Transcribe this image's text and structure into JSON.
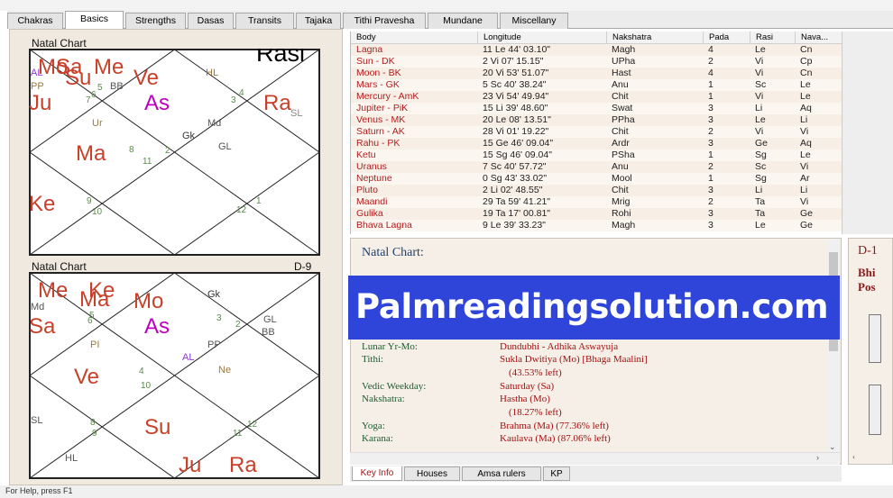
{
  "tabs": [
    "Chakras",
    "Basics",
    "Strengths",
    "Dasas",
    "Transits",
    "Tajaka",
    "Tithi Pravesha",
    "Mundane",
    "Miscellany"
  ],
  "active_tab": "Basics",
  "rasi_chart": {
    "title": "Natal Chart",
    "name": "Rasi",
    "planets": [
      {
        "label": "Mo",
        "color": "#c8402a",
        "size": 24
      },
      {
        "label": "Sa",
        "color": "#c8402a",
        "size": 24
      },
      {
        "label": "Me",
        "color": "#c8402a",
        "size": 24
      },
      {
        "label": "Su",
        "color": "#c8402a",
        "size": 24
      },
      {
        "label": "Ve",
        "color": "#c8402a",
        "size": 24
      },
      {
        "label": "AL",
        "color": "#8a3ad0",
        "size": 11
      },
      {
        "label": "PP",
        "color": "#9a7840",
        "size": 11
      },
      {
        "label": "BB",
        "color": "#555",
        "size": 11
      },
      {
        "label": "HL",
        "color": "#9a7840",
        "size": 11
      },
      {
        "label": "Ju",
        "color": "#c8402a",
        "size": 24
      },
      {
        "label": "As",
        "color": "#c000c0",
        "size": 24
      },
      {
        "label": "Ra",
        "color": "#c8402a",
        "size": 24
      },
      {
        "label": "SL",
        "color": "#888",
        "size": 11
      },
      {
        "label": "Ur",
        "color": "#9a7840",
        "size": 11
      },
      {
        "label": "Md",
        "color": "#555",
        "size": 11
      },
      {
        "label": "Gk",
        "color": "#333",
        "size": 11
      },
      {
        "label": "GL",
        "color": "#555",
        "size": 11
      },
      {
        "label": "Ma",
        "color": "#c8402a",
        "size": 24
      },
      {
        "label": "Ke",
        "color": "#c8402a",
        "size": 24
      }
    ],
    "house_numbers": [
      "6",
      "5",
      "7",
      "4",
      "3",
      "8",
      "2",
      "11",
      "9",
      "10",
      "12",
      "1"
    ]
  },
  "navamsa_chart": {
    "title": "Natal Chart",
    "name": "D-9",
    "planets": [
      {
        "label": "Me",
        "color": "#c8402a",
        "size": 24
      },
      {
        "label": "Ke",
        "color": "#c8402a",
        "size": 24
      },
      {
        "label": "Ma",
        "color": "#c8402a",
        "size": 24
      },
      {
        "label": "Mo",
        "color": "#c8402a",
        "size": 24
      },
      {
        "label": "Gk",
        "color": "#333",
        "size": 11
      },
      {
        "label": "Md",
        "color": "#555",
        "size": 11
      },
      {
        "label": "Sa",
        "color": "#c8402a",
        "size": 24
      },
      {
        "label": "As",
        "color": "#c000c0",
        "size": 24
      },
      {
        "label": "GL",
        "color": "#555",
        "size": 11
      },
      {
        "label": "BB",
        "color": "#555",
        "size": 11
      },
      {
        "label": "PI",
        "color": "#9a7840",
        "size": 11
      },
      {
        "label": "PP",
        "color": "#555",
        "size": 11
      },
      {
        "label": "AL",
        "color": "#8a3ad0",
        "size": 11
      },
      {
        "label": "Ve",
        "color": "#c8402a",
        "size": 24
      },
      {
        "label": "Ne",
        "color": "#9a7840",
        "size": 11
      },
      {
        "label": "SL",
        "color": "#555",
        "size": 11
      },
      {
        "label": "Su",
        "color": "#c8402a",
        "size": 24
      },
      {
        "label": "HL",
        "color": "#555",
        "size": 11
      },
      {
        "label": "Ju",
        "color": "#c8402a",
        "size": 24
      },
      {
        "label": "Ra",
        "color": "#c8402a",
        "size": 24
      }
    ],
    "house_numbers": [
      "6",
      "5",
      "3",
      "2",
      "4",
      "10",
      "8",
      "9",
      "11",
      "12"
    ]
  },
  "table": {
    "headers": [
      "Body",
      "Longitude",
      "Nakshatra",
      "Pada",
      "Rasi",
      "Nava..."
    ],
    "rows": [
      [
        "Lagna",
        "11 Le 44' 03.10\"",
        "Magh",
        "4",
        "Le",
        "Cn"
      ],
      [
        "Sun - DK",
        "2 Vi 07' 15.15\"",
        "UPha",
        "2",
        "Vi",
        "Cp"
      ],
      [
        "Moon - BK",
        "20 Vi 53' 51.07\"",
        "Hast",
        "4",
        "Vi",
        "Cn"
      ],
      [
        "Mars - GK",
        "5 Sc 40' 38.24\"",
        "Anu",
        "1",
        "Sc",
        "Le"
      ],
      [
        "Mercury - AmK",
        "23 Vi 54' 49.94\"",
        "Chit",
        "1",
        "Vi",
        "Le"
      ],
      [
        "Jupiter - PiK",
        "15 Li 39' 48.60\"",
        "Swat",
        "3",
        "Li",
        "Aq"
      ],
      [
        "Venus - MK",
        "20 Le 08' 13.51\"",
        "PPha",
        "3",
        "Le",
        "Li"
      ],
      [
        "Saturn - AK",
        "28 Vi 01' 19.22\"",
        "Chit",
        "2",
        "Vi",
        "Vi"
      ],
      [
        "Rahu - PK",
        "15 Ge 46' 09.04\"",
        "Ardr",
        "3",
        "Ge",
        "Aq"
      ],
      [
        "Ketu",
        "15 Sg 46' 09.04\"",
        "PSha",
        "1",
        "Sg",
        "Le"
      ],
      [
        "Uranus",
        "7 Sc 40' 57.72\"",
        "Anu",
        "2",
        "Sc",
        "Vi"
      ],
      [
        "Neptune",
        "0 Sg 43' 33.02\"",
        "Mool",
        "1",
        "Sg",
        "Ar"
      ],
      [
        "Pluto",
        "2 Li 02' 48.55\"",
        "Chit",
        "3",
        "Li",
        "Li"
      ],
      [
        "Maandi",
        "29 Ta 59' 41.21\"",
        "Mrig",
        "2",
        "Ta",
        "Vi"
      ],
      [
        "Gulika",
        "19 Ta 17' 00.81\"",
        "Rohi",
        "3",
        "Ta",
        "Ge"
      ],
      [
        "Bhava Lagna",
        "9 Le 39' 33.23\"",
        "Magh",
        "3",
        "Le",
        "Ge"
      ]
    ]
  },
  "info": {
    "heading": "Natal Chart:",
    "items": [
      {
        "label": "Lunar Yr-Mo:",
        "value": "Dundubhi - Adhika Aswayuja"
      },
      {
        "label": "Tithi:",
        "value": "Sukla Dwitiya (Mo) [Bhaga Maalini]"
      },
      {
        "label": "",
        "value": "(43.53% left)"
      },
      {
        "label": "Vedic Weekday:",
        "value": "Saturday (Sa)"
      },
      {
        "label": "Nakshatra:",
        "value": "Hastha (Mo)"
      },
      {
        "label": "",
        "value": "(18.27% left)"
      },
      {
        "label": "Yoga:",
        "value": "Brahma (Ma) (77.36% left)"
      },
      {
        "label": "Karana:",
        "value": "Kaulava (Ma) (87.06% left)"
      }
    ]
  },
  "bottom_tabs": [
    "Key Info",
    "Houses",
    "Amsa rulers",
    "KP"
  ],
  "active_bottom_tab": "Key Info",
  "d_panel": {
    "title": "D-1",
    "line1": "Bhi",
    "line2": "Pos"
  },
  "banner": "Palmreadingsolution.com",
  "status": "For Help, press F1"
}
